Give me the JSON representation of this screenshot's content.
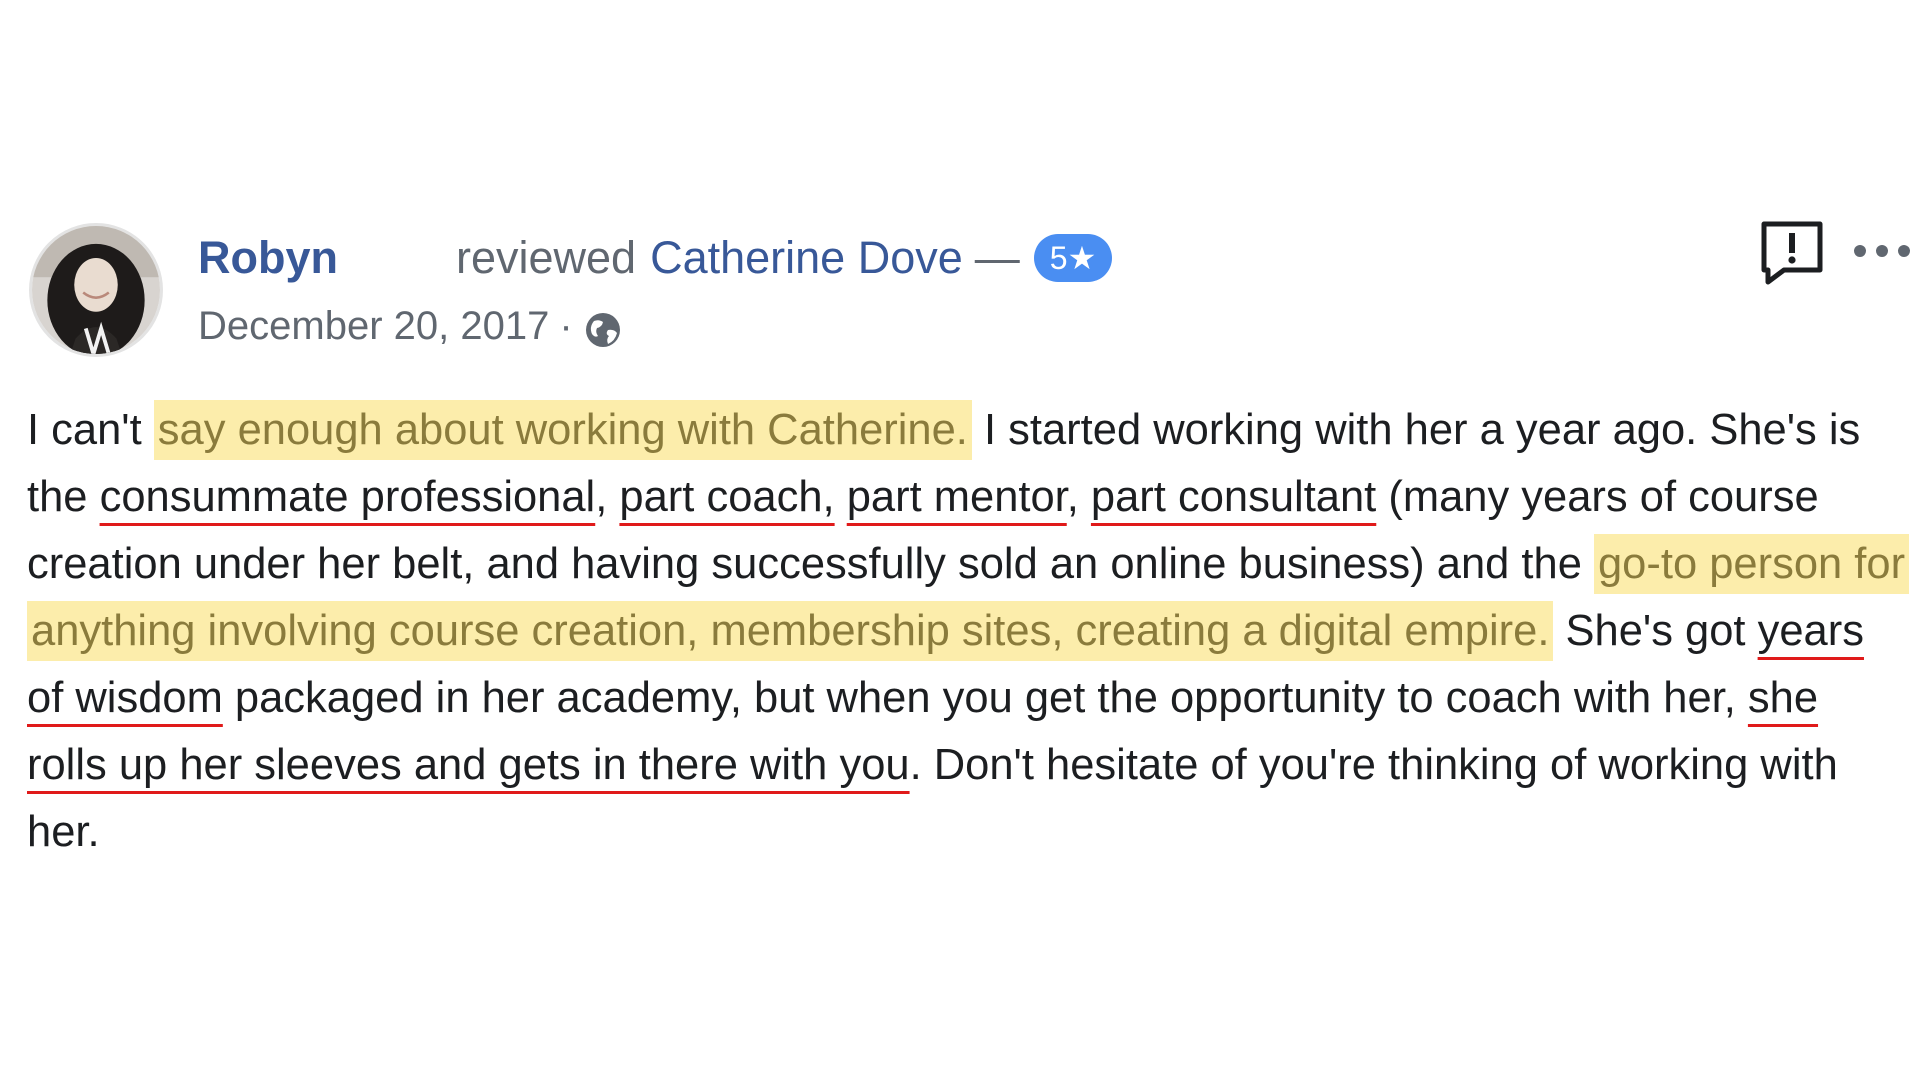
{
  "review": {
    "author": "Robyn",
    "action_text": "reviewed",
    "page_name": "Catherine Dove",
    "dash": "—",
    "rating_badge": "5★",
    "date": "December 20, 2017",
    "date_separator": "·",
    "privacy_icon": "globe-icon",
    "report_icon": "report-flag-icon",
    "more_icon": "more-options-icon",
    "body": [
      {
        "text": "I can't ",
        "style": "plain"
      },
      {
        "text": "say enough about working with Catherine.",
        "style": "highlight"
      },
      {
        "text": " I started working with her a year ago. She's is the ",
        "style": "plain"
      },
      {
        "text": "consummate professional",
        "style": "underline"
      },
      {
        "text": ", ",
        "style": "plain"
      },
      {
        "text": "part coach,",
        "style": "underline"
      },
      {
        "text": " ",
        "style": "plain"
      },
      {
        "text": "part mentor",
        "style": "underline"
      },
      {
        "text": ", ",
        "style": "plain"
      },
      {
        "text": "part consultant",
        "style": "underline"
      },
      {
        "text": " (many years of course creation under her belt, and having successfully sold an online business) and the ",
        "style": "plain"
      },
      {
        "text": "go-to person for anything involving course creation, membership sites, creating a digital empire.",
        "style": "highlight"
      },
      {
        "text": " She's got ",
        "style": "plain"
      },
      {
        "text": "years of wisdom",
        "style": "underline"
      },
      {
        "text": " packaged in her academy, but when you get the opportunity to coach with her, ",
        "style": "plain"
      },
      {
        "text": "she rolls up her sleeves and gets in there with you",
        "style": "underline"
      },
      {
        "text": ". Don't hesitate of you're thinking of working with her.",
        "style": "plain"
      }
    ]
  },
  "colors": {
    "link": "#385898",
    "muted": "#606770",
    "badge": "#4a8ef2",
    "highlight_bg": "#fcedab",
    "highlight_text": "#8a7b3c",
    "underline": "#e01a1a",
    "body_text": "#1c1e21"
  }
}
